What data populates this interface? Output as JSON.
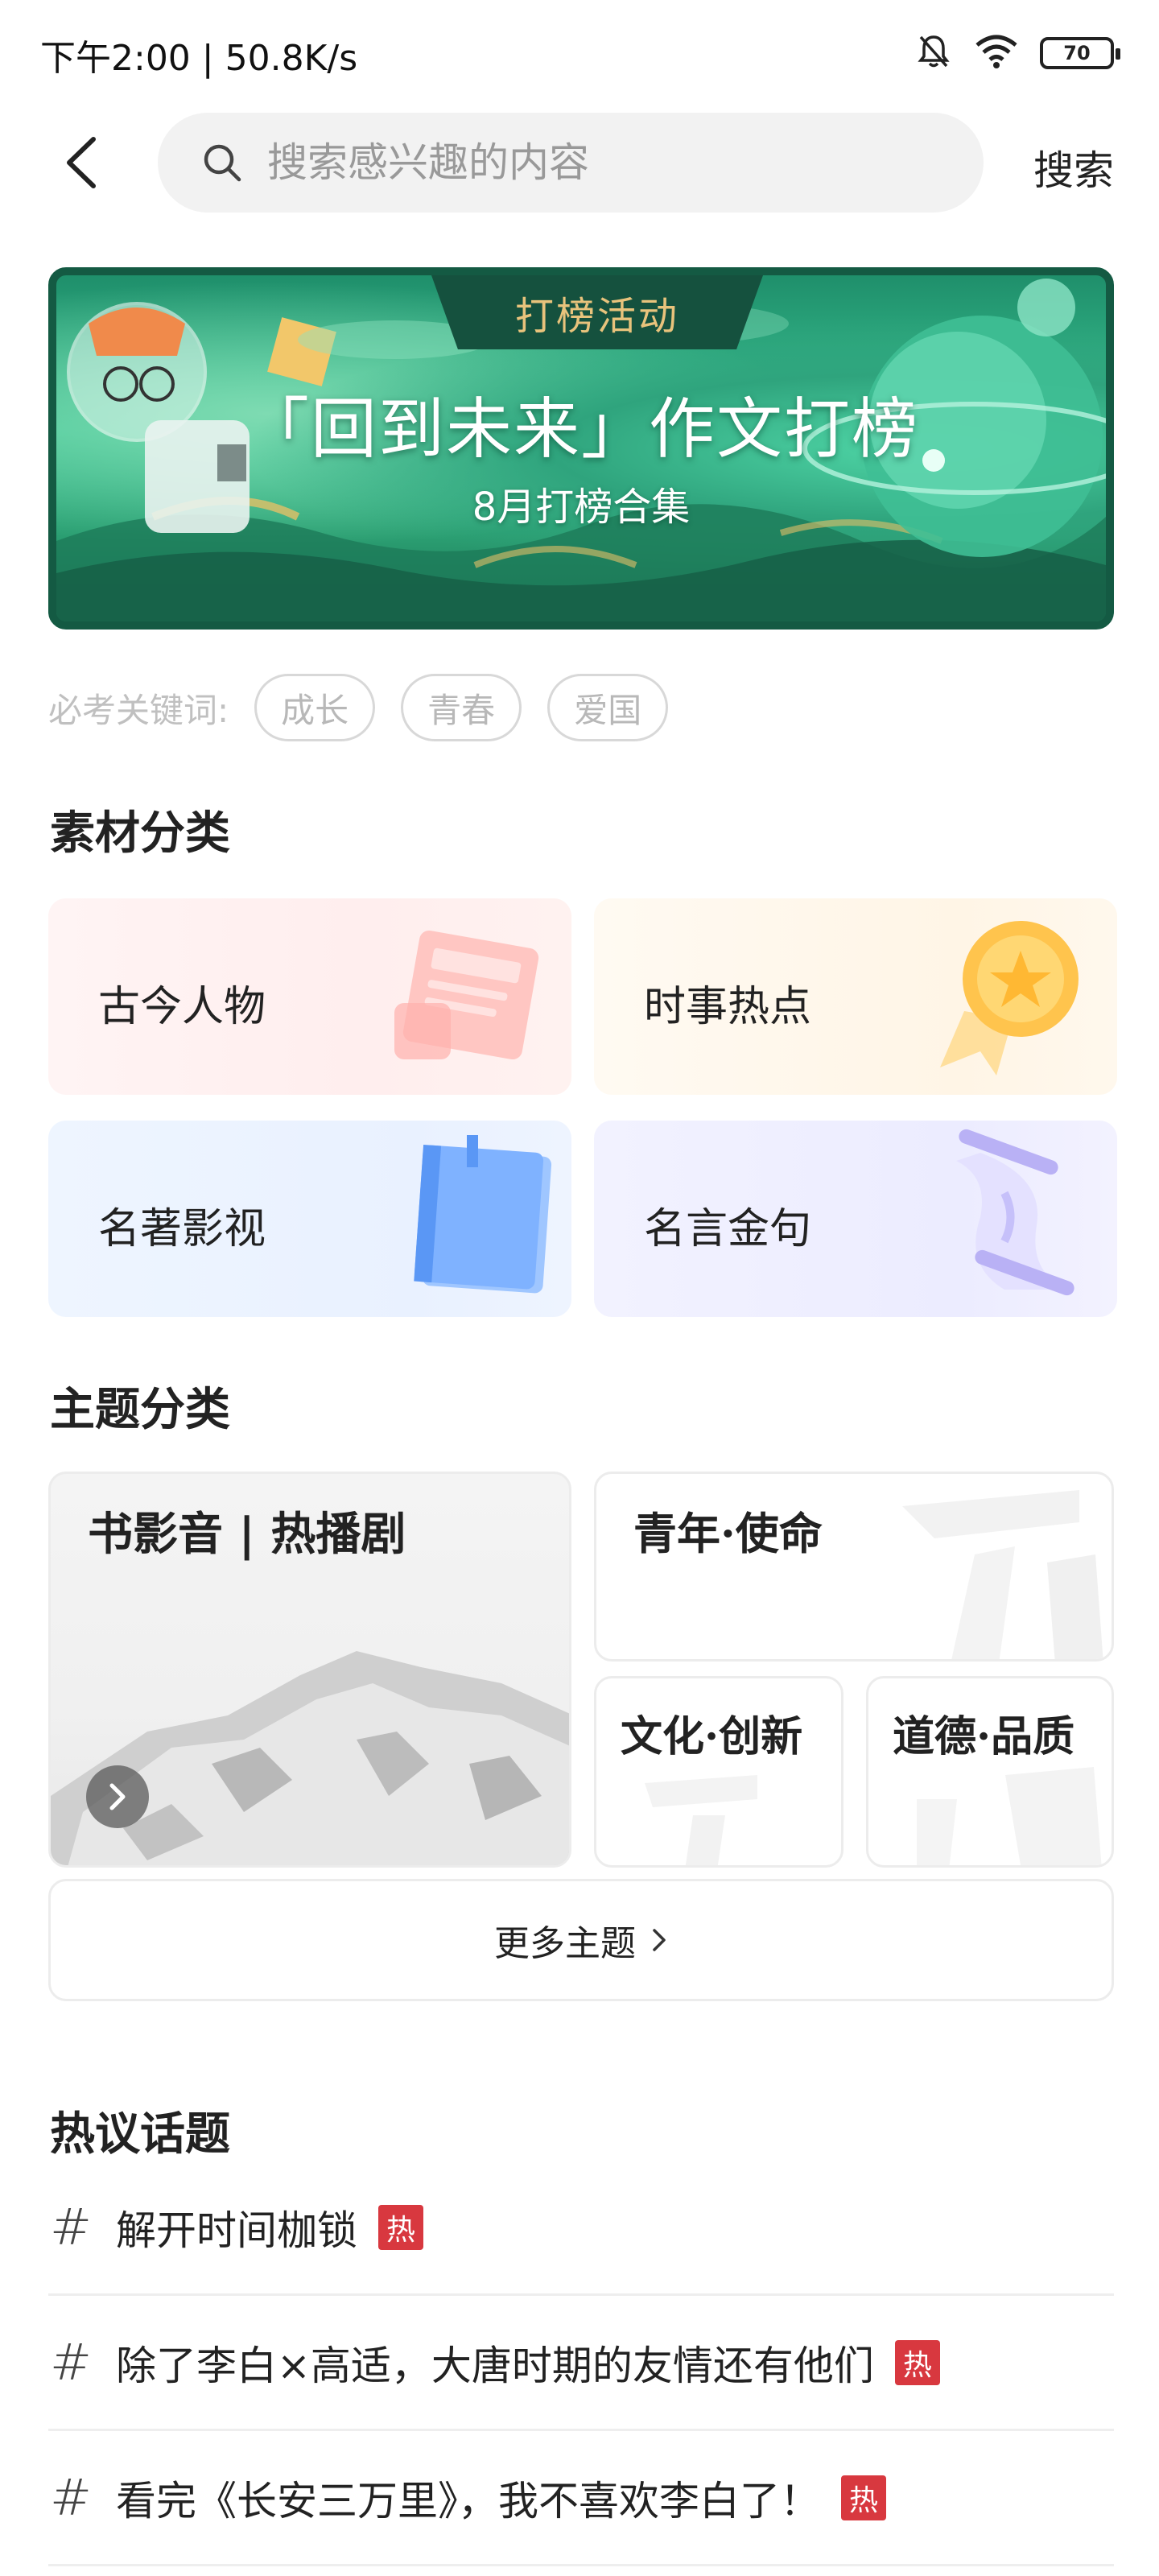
{
  "status_bar": {
    "left_text": "下午2:00 | 50.8K/s",
    "battery": "70",
    "icons": [
      "bell-off-icon",
      "wifi-icon",
      "battery-icon"
    ]
  },
  "search": {
    "placeholder": "搜索感兴趣的内容",
    "action_label": "搜索"
  },
  "banner": {
    "tag": "打榜活动",
    "title": "「回到未来」作文打榜",
    "subtitle": "8月打榜合集"
  },
  "keywords": {
    "label": "必考关键词:",
    "chips": [
      "成长",
      "青春",
      "爱国"
    ]
  },
  "material_section": {
    "title": "素材分类",
    "items": [
      {
        "label": "古今人物",
        "icon": "newspaper-icon"
      },
      {
        "label": "时事热点",
        "icon": "medal-icon"
      },
      {
        "label": "名著影视",
        "icon": "book-icon"
      },
      {
        "label": "名言金句",
        "icon": "scroll-icon"
      }
    ]
  },
  "theme_section": {
    "title": "主题分类",
    "items": [
      {
        "label": "书影音 | 热播剧"
      },
      {
        "label": "青年·使命"
      },
      {
        "label": "文化·创新"
      },
      {
        "label": "道德·品质"
      }
    ],
    "more_label": "更多主题"
  },
  "hot_topics": {
    "title": "热议话题",
    "hot_badge": "热",
    "items": [
      {
        "text": "解开时间枷锁"
      },
      {
        "text": "除了李白×高适，大唐时期的友情还有他们"
      },
      {
        "text": "看完《长安三万里》，我不喜欢李白了！"
      }
    ]
  },
  "colors": {
    "hot_red": "#d8383f",
    "banner_green": "#2fa47d",
    "banner_gold": "#e8c37c"
  }
}
